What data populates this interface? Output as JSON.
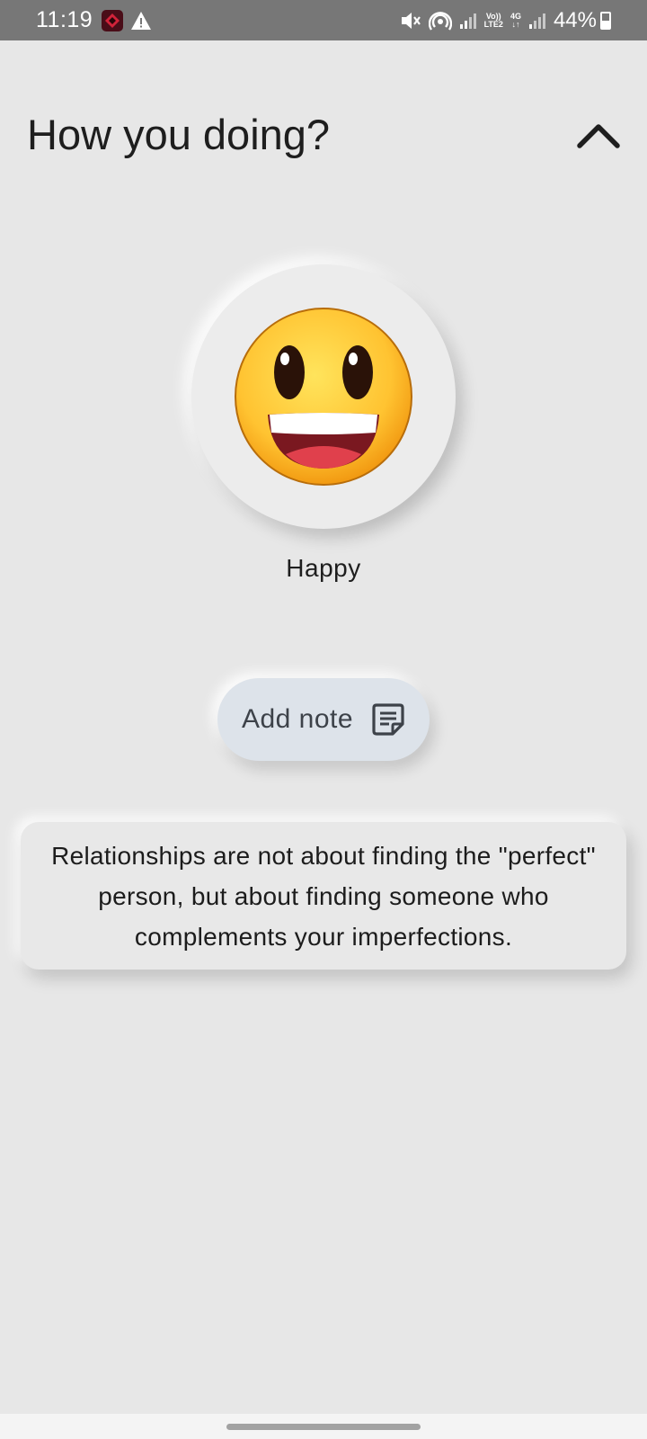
{
  "status_bar": {
    "time": "11:19",
    "volte_label_top": "Vo))",
    "volte_label_bottom": "LTE2",
    "network_type": "4G",
    "battery_percent": "44%",
    "battery_level": 0.44
  },
  "header": {
    "title": "How you doing?",
    "collapse_icon": "chevron-up-icon"
  },
  "mood": {
    "emoji": "grinning-face",
    "label": "Happy"
  },
  "note": {
    "button_label": "Add note",
    "icon": "note-icon"
  },
  "quote": {
    "text": "Relationships are not about finding the \"perfect\" person, but about finding someone who complements your imperfections."
  },
  "colors": {
    "background": "#e7e7e7",
    "status_bar": "#777777",
    "note_button": "#dde3ea",
    "emoji_yellow": "#ffc83a"
  }
}
